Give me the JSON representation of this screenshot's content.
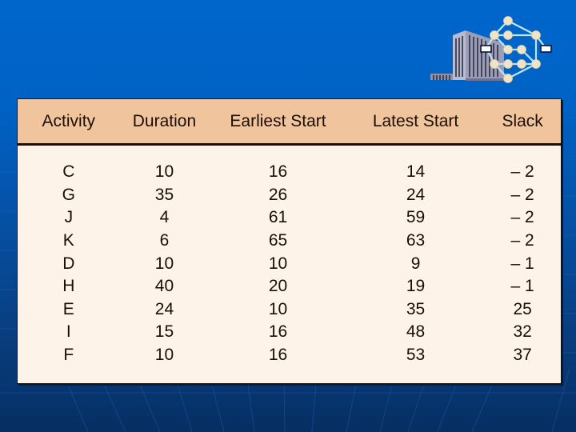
{
  "slide": {
    "logo_icon": "building-network-icon",
    "table": {
      "headers": [
        "Activity",
        "Duration",
        "Earliest Start",
        "Latest Start",
        "Slack"
      ],
      "rows": [
        [
          "C",
          "10",
          "16",
          "14",
          "– 2"
        ],
        [
          "G",
          "35",
          "26",
          "24",
          "– 2"
        ],
        [
          "J",
          "4",
          "61",
          "59",
          "– 2"
        ],
        [
          "K",
          "6",
          "65",
          "63",
          "– 2"
        ],
        [
          "D",
          "10",
          "10",
          "9",
          "– 1"
        ],
        [
          "H",
          "40",
          "20",
          "19",
          "– 1"
        ],
        [
          "E",
          "24",
          "10",
          "35",
          "25"
        ],
        [
          "I",
          "15",
          "16",
          "48",
          "32"
        ],
        [
          "F",
          "10",
          "16",
          "53",
          "37"
        ]
      ]
    },
    "colors": {
      "background_top": "#0066cc",
      "background_bottom": "#062f63",
      "header_fill": "#f0c49c",
      "body_fill": "#fdf3e8",
      "text": "#1a0e05"
    }
  }
}
